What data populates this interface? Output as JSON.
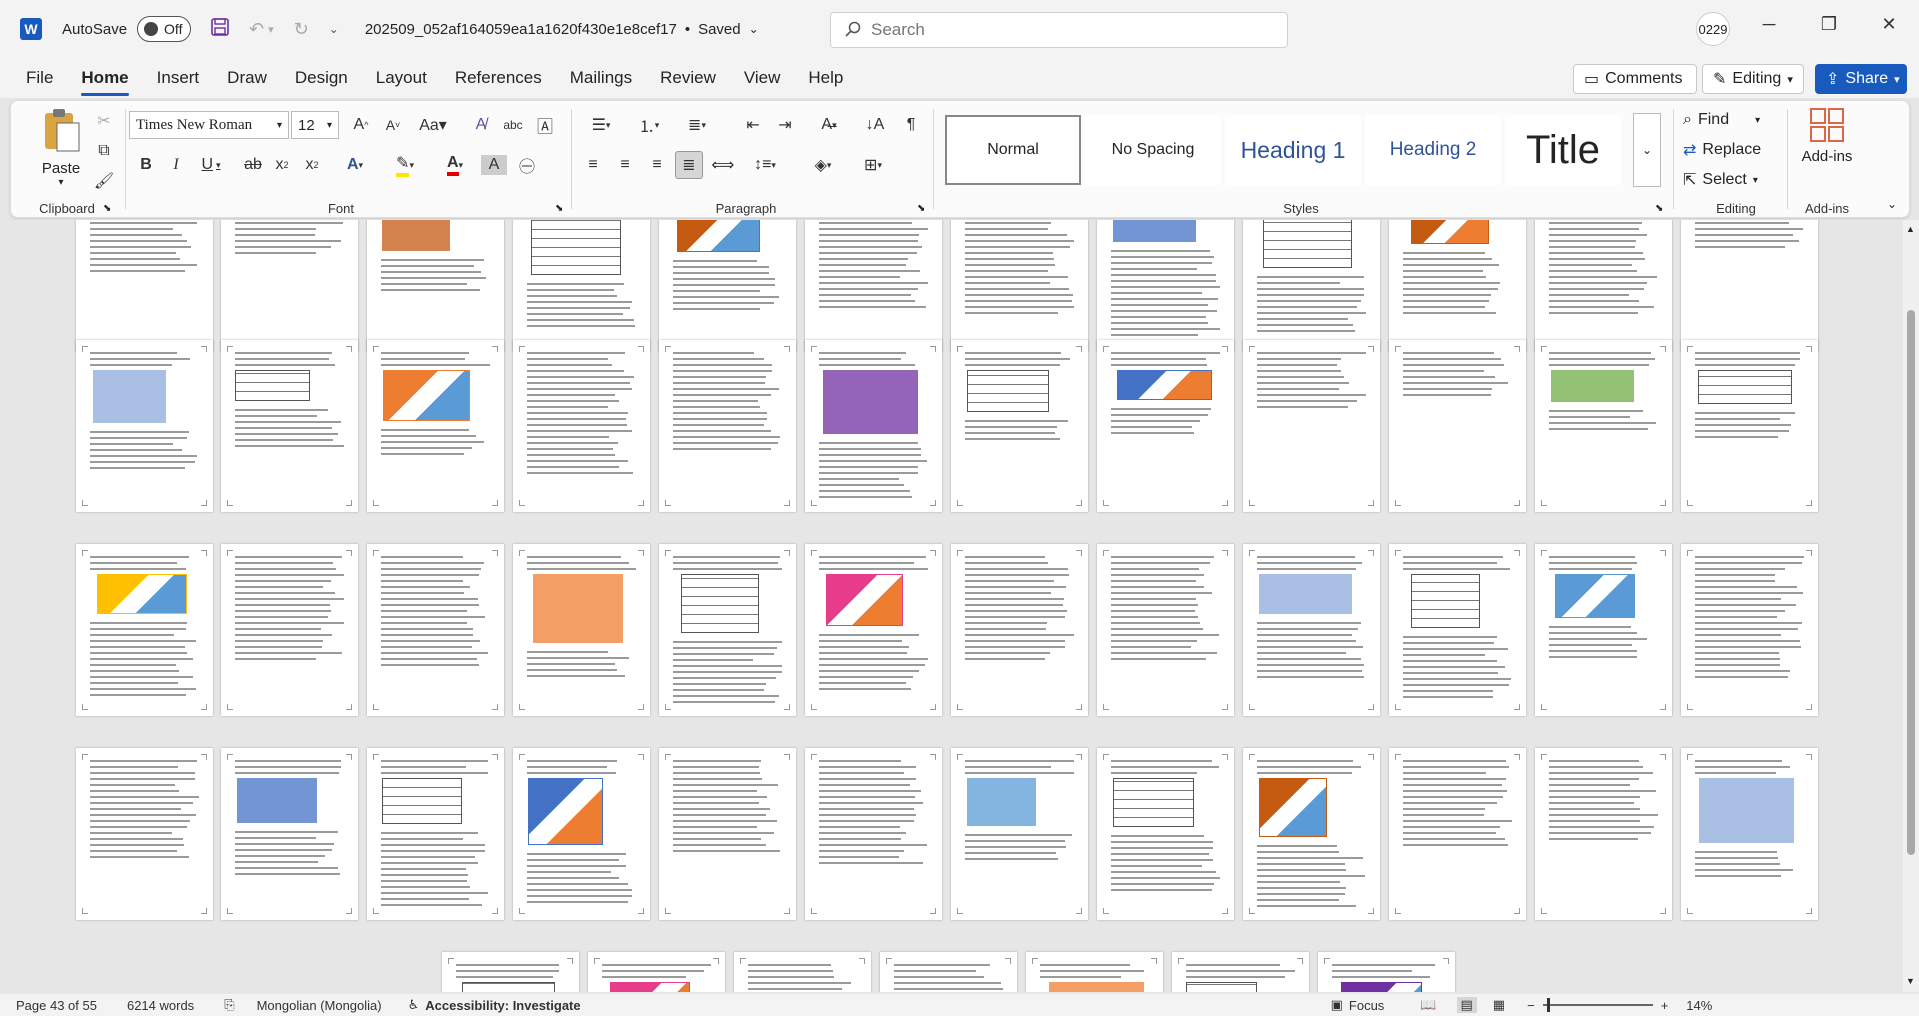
{
  "titlebar": {
    "app_letter": "W",
    "autosave_label": "AutoSave",
    "autosave_state": "Off",
    "document_name": "202509_052af164059ea1a1620f430e1e8cef17",
    "save_status": "Saved",
    "search_placeholder": "Search",
    "user_initials": "0229"
  },
  "menu": {
    "tabs": [
      "File",
      "Home",
      "Insert",
      "Draw",
      "Design",
      "Layout",
      "References",
      "Mailings",
      "Review",
      "View",
      "Help"
    ],
    "active_tab": "Home",
    "comments_label": "Comments",
    "editing_label": "Editing",
    "share_label": "Share"
  },
  "ribbon": {
    "clipboard": {
      "label": "Clipboard",
      "paste": "Paste"
    },
    "font": {
      "label": "Font",
      "font_name": "Times New Roman",
      "font_size": "12"
    },
    "paragraph": {
      "label": "Paragraph"
    },
    "styles": {
      "label": "Styles",
      "items": [
        "Normal",
        "No Spacing",
        "Heading 1",
        "Heading 2",
        "Title"
      ]
    },
    "editing": {
      "label": "Editing",
      "find": "Find",
      "replace": "Replace",
      "select": "Select"
    },
    "addins": {
      "label": "Add-ins",
      "button": "Add-ins"
    },
    "accent_color": "#185abd",
    "heading_color": "#2f5496"
  },
  "status": {
    "page": "Page 43 of 55",
    "words": "6214 words",
    "language": "Mongolian (Mongolia)",
    "accessibility": "Accessibility: Investigate",
    "focus": "Focus",
    "zoom": "14%"
  }
}
